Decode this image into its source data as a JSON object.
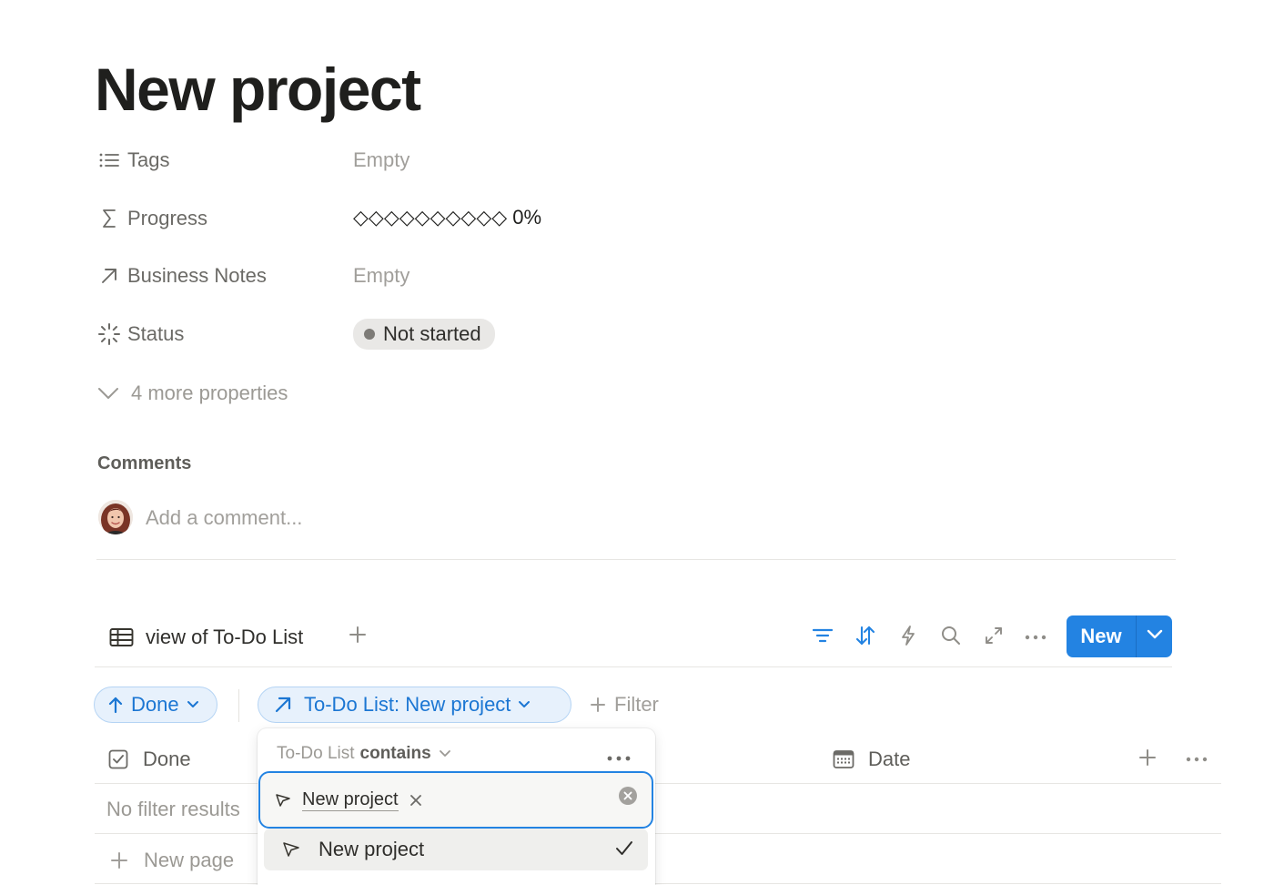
{
  "page": {
    "title": "New project"
  },
  "properties": {
    "tags": {
      "label": "Tags",
      "value": "Empty",
      "icon": "list-icon"
    },
    "progress": {
      "label": "Progress",
      "value": "◇◇◇◇◇◇◇◇◇◇ 0%",
      "percent": 0,
      "icon": "sigma-icon"
    },
    "business_notes": {
      "label": "Business Notes",
      "value": "Empty",
      "icon": "arrow-up-right-icon"
    },
    "status": {
      "label": "Status",
      "value": "Not started",
      "icon": "loader-icon"
    },
    "more": "4 more properties"
  },
  "comments": {
    "heading": "Comments",
    "placeholder": "Add a comment..."
  },
  "database": {
    "view_label": "view of To-Do List",
    "new_button": "New",
    "sort_chip": "Done",
    "filter_chip": "To-Do List: New project",
    "add_filter": "Filter",
    "columns": {
      "done": "Done",
      "date": "Date"
    },
    "empty_row": "No filter results",
    "new_page": "New page"
  },
  "filter_popover": {
    "property": "To-Do List",
    "operator": "contains",
    "selected_token": "New project",
    "option": "New project"
  },
  "colors": {
    "accent": "#2383e2",
    "chip_bg": "#e7f1fc",
    "chip_text": "#1b76d3",
    "status_pill": "#e9e8e6"
  }
}
